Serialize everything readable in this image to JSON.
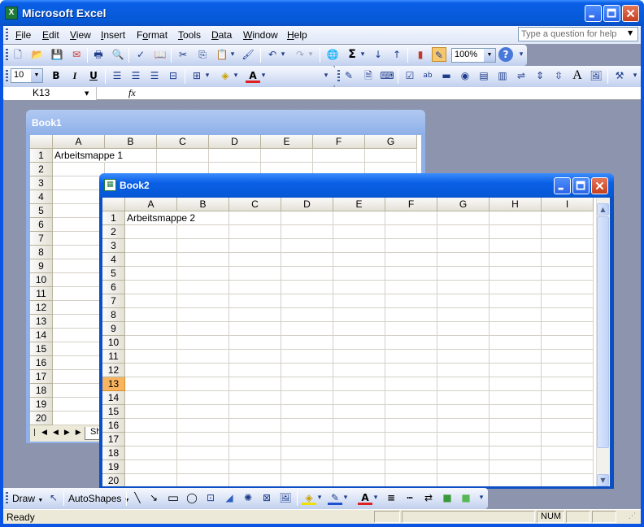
{
  "app": {
    "title": "Microsoft Excel",
    "icon": "excel-icon"
  },
  "menu": [
    {
      "label": "File",
      "accel": "F"
    },
    {
      "label": "Edit",
      "accel": "E"
    },
    {
      "label": "View",
      "accel": "V"
    },
    {
      "label": "Insert",
      "accel": "I"
    },
    {
      "label": "Format",
      "accel": "o"
    },
    {
      "label": "Tools",
      "accel": "T"
    },
    {
      "label": "Data",
      "accel": "D"
    },
    {
      "label": "Window",
      "accel": "W"
    },
    {
      "label": "Help",
      "accel": "H"
    }
  ],
  "help": {
    "placeholder": "Type a question for help"
  },
  "toolbar": {
    "zoom": "100%",
    "font_size": "10",
    "sum_glyph": "Σ"
  },
  "formula_bar": {
    "name_box": "K13",
    "fx": "fx"
  },
  "book1": {
    "title": "Book1",
    "columns": [
      "A",
      "B",
      "C",
      "D",
      "E",
      "F",
      "G"
    ],
    "rows": [
      "1",
      "2",
      "3",
      "4",
      "5",
      "6",
      "7",
      "8",
      "9",
      "10",
      "11",
      "12",
      "13",
      "14",
      "15",
      "16",
      "17",
      "18",
      "19",
      "20"
    ],
    "a1": "Arbeitsmappe 1",
    "sheet_tab": "Sh"
  },
  "book2": {
    "title": "Book2",
    "columns": [
      "A",
      "B",
      "C",
      "D",
      "E",
      "F",
      "G",
      "H",
      "I"
    ],
    "rows": [
      "1",
      "2",
      "3",
      "4",
      "5",
      "6",
      "7",
      "8",
      "9",
      "10",
      "11",
      "12",
      "13",
      "14",
      "15",
      "16",
      "17",
      "18",
      "19",
      "20"
    ],
    "a1": "Arbeitsmappe 2",
    "selected_row": "13"
  },
  "draw_toolbar": {
    "draw_label": "Draw",
    "autoshapes_label": "AutoShapes"
  },
  "status": {
    "text": "Ready",
    "num": "NUM"
  },
  "colors": {
    "titlebar": "#0a5fe6",
    "selected_header": "#f8b45e",
    "workspace": "#8c95ad"
  }
}
